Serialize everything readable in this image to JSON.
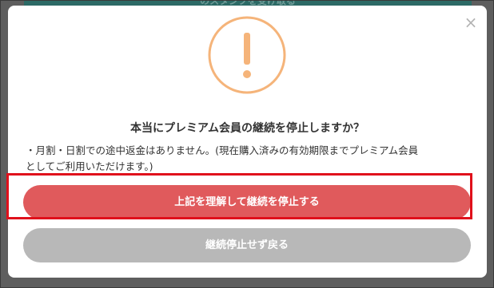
{
  "background": {
    "button_label": "のスタンプを受け取る"
  },
  "modal": {
    "close_icon": "close-icon",
    "alert_icon": "exclamation-circle-icon",
    "alert_color": "#f5b47a",
    "title": "本当にプレミアム会員の継続を停止しますか？",
    "body_line1": "・月割・日割での途中返金はありません。(現在購入済みの有効期限までプレミアム会員",
    "body_line2": "としてご利用いただけます。)",
    "confirm_stop_label": "上記を理解して継続を停止する",
    "confirm_color": "#e05a5c",
    "cancel_label": "継続停止せず戻る",
    "cancel_color": "#b8b8b8",
    "highlight_color": "#e0101b"
  }
}
